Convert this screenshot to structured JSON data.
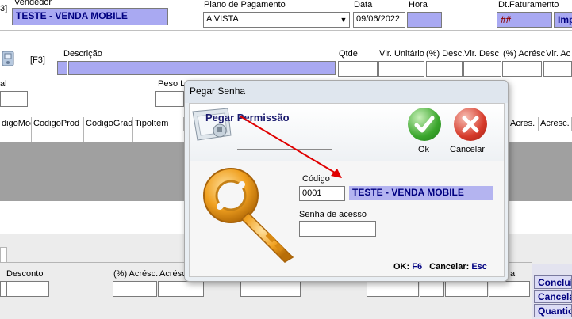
{
  "header": {
    "bracket_label": "3]",
    "vendedor_label": "Vendedor",
    "vendedor_value": "TESTE - VENDA MOBILE",
    "plano_label": "Plano de Pagamento",
    "plano_value": "A VISTA",
    "data_label": "Data",
    "data_value": "09/06/2022",
    "hora_label": "Hora",
    "hora_value": "",
    "dt_fat_label": "Dt.Faturamento",
    "dt_fat_value": "##",
    "imp_label": "Imp"
  },
  "items_row": {
    "f3_label": "[F3]",
    "descricao_label": "Descrição",
    "qtde_label": "Qtde",
    "vlr_unit_label": "Vlr. Unitário",
    "desc_pct_label": "(%) Desc.",
    "vlr_desc_label": "Vlr. Desc",
    "acresc_pct_label": "(%) Acrésc",
    "vlr_ac_label": "Vlr. Ac",
    "al_label": "al",
    "peso_label": "Peso L"
  },
  "grid": {
    "columns": [
      "digoMode",
      "CodigoProd",
      "CodigoGrade",
      "TipoItem"
    ],
    "right_columns": [
      "Acres.",
      "Acresc."
    ]
  },
  "footer": {
    "desconto_label": "Desconto",
    "acresc_pct_label": "(%) Acrésc.",
    "acresc_label": "Acrésc",
    "a_label": "a",
    "buttons": [
      "Concluí",
      "Cancela",
      "Quantid"
    ]
  },
  "dialog": {
    "title": "Pegar Senha",
    "heading": "Pegar Permissão",
    "ok_label": "Ok",
    "cancel_label": "Cancelar",
    "codigo_label": "Código",
    "codigo_value": "0001",
    "codigo_name": "TESTE - VENDA MOBILE",
    "senha_label": "Senha de acesso",
    "senha_value": "",
    "shortcut_ok_label": "OK:",
    "shortcut_ok_key": "F6",
    "shortcut_cancel_label": "Cancelar:",
    "shortcut_cancel_key": "Esc"
  },
  "colors": {
    "highlight_field": "#a9a9f2",
    "dark_blue_text": "#000080",
    "grid_background": "#a0a0a0",
    "ok_green": "#3aa62c",
    "cancel_red": "#d63a2a",
    "key_orange": "#f0a020"
  }
}
